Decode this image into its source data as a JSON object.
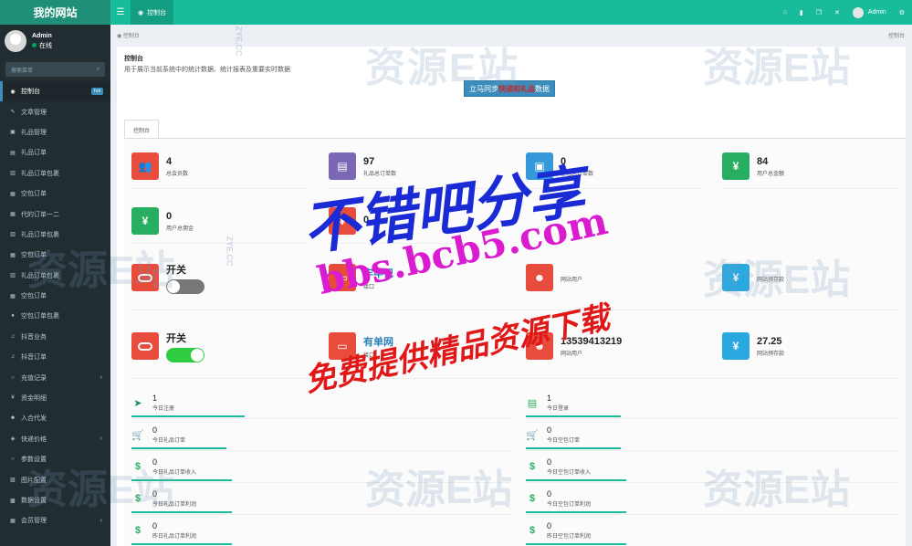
{
  "brand": "我的网站",
  "topbar": {
    "tab_label": "控制台",
    "user": "Admin"
  },
  "sidebar": {
    "user": "Admin",
    "status": "在线",
    "search_placeholder": "搜索菜单",
    "items": [
      {
        "label": "控制台",
        "icon": "dashboard-icon",
        "badge": "hot",
        "active": true
      },
      {
        "label": "文章管理",
        "icon": "pencil-icon"
      },
      {
        "label": "礼品管理",
        "icon": "gift-icon"
      },
      {
        "label": "礼品订单",
        "icon": "order-icon"
      },
      {
        "label": "礼品订单包裹",
        "icon": "box-icon"
      },
      {
        "label": "空包订单",
        "icon": "list-icon"
      },
      {
        "label": "代的订单一二",
        "icon": "list-icon"
      },
      {
        "label": "礼品订单包裹",
        "icon": "box-icon"
      },
      {
        "label": "空包订单",
        "icon": "list-icon"
      },
      {
        "label": "礼品订单包裹",
        "icon": "box-icon"
      },
      {
        "label": "空包订单",
        "icon": "list-icon"
      },
      {
        "label": "空包订单包裹",
        "icon": "user-icon"
      },
      {
        "label": "抖音业务",
        "icon": "music-icon"
      },
      {
        "label": "抖音订单",
        "icon": "music-icon"
      },
      {
        "label": "充值记录",
        "icon": "circle-icon",
        "chevron": true
      },
      {
        "label": "资金明细",
        "icon": "yen-icon"
      },
      {
        "label": "入合代发",
        "icon": "users-icon"
      },
      {
        "label": "快递价格",
        "icon": "tag-icon",
        "chevron": true
      },
      {
        "label": "参数设置",
        "icon": "circle-icon"
      },
      {
        "label": "图片配置",
        "icon": "image-icon"
      },
      {
        "label": "数据设置",
        "icon": "database-icon"
      },
      {
        "label": "会员管理",
        "icon": "list-icon",
        "chevron": true
      }
    ]
  },
  "breadcrumb": "控制台",
  "breadcrumb_right": "控制台",
  "page": {
    "title": "控制台",
    "desc": "用于展示当前系统中的统计数据、统计报表及重要实时数据"
  },
  "sync_button": {
    "prefix": "立马同步",
    "highlight": "快递和礼品",
    "suffix": "数据"
  },
  "inner_tab": "控制台",
  "stats": [
    {
      "value": "4",
      "label": "总会员数",
      "color": "#e74c3c",
      "icon": "users-icon",
      "glyph": "👥"
    },
    {
      "value": "97",
      "label": "礼品总订单数",
      "color": "#7b68b5",
      "icon": "book-icon",
      "glyph": "▤"
    },
    {
      "value": "0",
      "label": "空包总订单数",
      "color": "#3498db",
      "icon": "box-icon",
      "glyph": "▣"
    },
    {
      "value": "84",
      "label": "用户总金额",
      "color": "#27ae60",
      "icon": "yen-icon",
      "glyph": "¥"
    },
    {
      "value": "0",
      "label": "用户总佣金",
      "color": "#27ae60",
      "icon": "yen-icon",
      "glyph": "¥"
    },
    {
      "value": "0",
      "label": "",
      "color": "#e74c3c",
      "icon": "yen-icon",
      "glyph": "¥"
    }
  ],
  "switches": [
    {
      "title": "开关",
      "on": false
    },
    {
      "title": "开关",
      "on": true
    }
  ],
  "links": [
    {
      "value": "牢牢记",
      "label": "接口"
    },
    {
      "value": "有单网",
      "label": "接口"
    }
  ],
  "users": [
    {
      "value": "",
      "label": "网站用户"
    },
    {
      "value": "13539413219",
      "label": "网站用户"
    }
  ],
  "balances": [
    {
      "value": "",
      "label": "网站预存款"
    },
    {
      "value": "27.25",
      "label": "网站预存款"
    }
  ],
  "mini_left": [
    {
      "value": "1",
      "label": "今日注册",
      "icon": "rocket-icon",
      "glyph": "➤"
    },
    {
      "value": "0",
      "label": "今日礼品订单",
      "icon": "cart-icon",
      "glyph": "🛒"
    },
    {
      "value": "0",
      "label": "今日礼品订单收入",
      "icon": "dollar-icon",
      "glyph": "$"
    },
    {
      "value": "0",
      "label": "今日礼品订单利润",
      "icon": "dollar-icon",
      "glyph": "$"
    },
    {
      "value": "0",
      "label": "昨日礼品订单利润",
      "icon": "dollar-icon",
      "glyph": "$"
    }
  ],
  "mini_right": [
    {
      "value": "1",
      "label": "今日登录",
      "icon": "list-icon",
      "glyph": "▤"
    },
    {
      "value": "0",
      "label": "今日空包订单",
      "icon": "cart-icon",
      "glyph": "🛒"
    },
    {
      "value": "0",
      "label": "今日空包订单收入",
      "icon": "dollar-icon",
      "glyph": "$"
    },
    {
      "value": "0",
      "label": "今日空包订单利润",
      "icon": "dollar-icon",
      "glyph": "$"
    },
    {
      "value": "0",
      "label": "昨日空包订单利润",
      "icon": "dollar-icon",
      "glyph": "$"
    }
  ],
  "watermarks": {
    "line1": "不错吧分享",
    "line2": "bbs.bcb5.com",
    "line3": "免费提供精品资源下载",
    "stamp": "资源E站",
    "stamp_small": "ZYE.CC"
  },
  "colors": {
    "accent": "#18bc9c",
    "sidebar": "#222d32",
    "primary": "#3c8dbc"
  }
}
